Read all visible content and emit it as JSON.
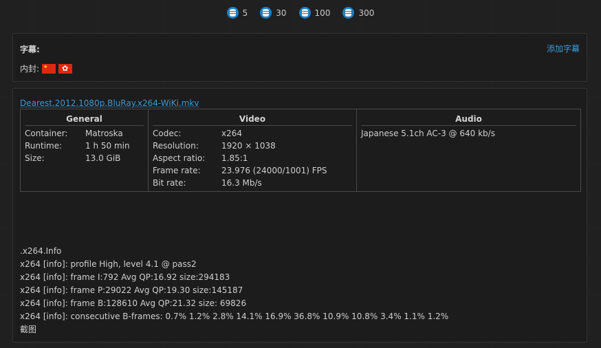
{
  "coins": [
    {
      "icon": "coin-stack-icon",
      "label": "5"
    },
    {
      "icon": "coin-stack-icon",
      "label": "30"
    },
    {
      "icon": "coin-stack-icon",
      "label": "100"
    },
    {
      "icon": "coin-stack-icon",
      "label": "300"
    }
  ],
  "subtitles": {
    "title": "字幕:",
    "add_label": "添加字幕",
    "embedded_label": "内封:",
    "flags": [
      "cn-flag-icon",
      "hk-flag-icon"
    ]
  },
  "media": {
    "filename": "Dearest.2012.1080p.BluRay.x264-WiKi.mkv",
    "general": {
      "header": "General",
      "rows": [
        {
          "key": "Container:",
          "value": "Matroska"
        },
        {
          "key": "Runtime:",
          "value": "1 h 50 min"
        },
        {
          "key": "Size:",
          "value": "13.0 GiB"
        }
      ]
    },
    "video": {
      "header": "Video",
      "rows": [
        {
          "key": "Codec:",
          "value": "x264"
        },
        {
          "key": "Resolution:",
          "value": "1920 × 1038"
        },
        {
          "key": "Aspect ratio:",
          "value": "1.85:1"
        },
        {
          "key": "Frame rate:",
          "value": "23.976 (24000/1001) FPS"
        },
        {
          "key": "Bit rate:",
          "value": "16.3 Mb/s"
        }
      ]
    },
    "audio": {
      "header": "Audio",
      "rows": [
        "Japanese 5.1ch AC-3 @ 640 kb/s"
      ]
    },
    "log": [
      ".x264.Info",
      "x264 [info]: profile High, level 4.1 @ pass2",
      "x264 [info]: frame I:792 Avg QP:16.92 size:294183",
      "x264 [info]: frame P:29022 Avg QP:19.30 size:145187",
      "x264 [info]: frame B:128610 Avg QP:21.32 size: 69826",
      "x264 [info]: consecutive B-frames: 0.7% 1.2% 2.8% 14.1% 16.9% 36.8% 10.9% 10.8% 3.4% 1.1% 1.2%",
      "截图"
    ]
  },
  "colors": {
    "link": "#3e9ad4",
    "coin": "#1b7fc4",
    "background": "#1f1f1f",
    "panel_border": "#343434"
  }
}
